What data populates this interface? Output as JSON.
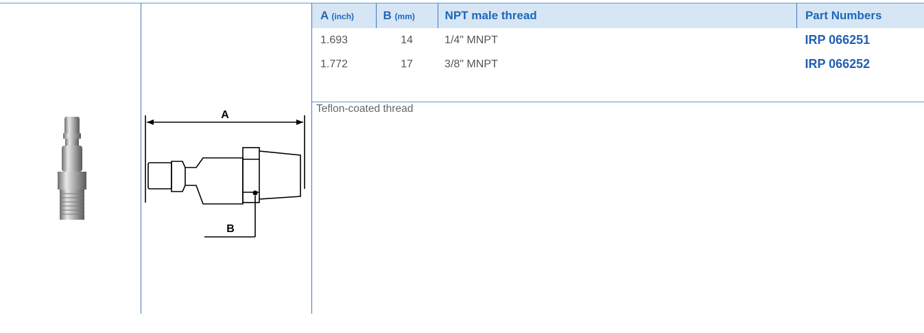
{
  "table": {
    "headers": {
      "a": {
        "label": "A",
        "unit": "(inch)"
      },
      "b": {
        "label": "B",
        "unit": "(mm)"
      },
      "thread": {
        "label": "NPT male thread"
      },
      "parts": {
        "label": "Part Numbers"
      }
    },
    "rows": [
      {
        "a": "1.693",
        "b": "14",
        "thread": "1/4\" MNPT",
        "part": "IRP 066251"
      },
      {
        "a": "1.772",
        "b": "17",
        "thread": "3/8\" MNPT",
        "part": "IRP 066252"
      }
    ]
  },
  "note": "Teflon-coated thread",
  "drawing": {
    "dim_a_label": "A",
    "dim_b_label": "B"
  },
  "colors": {
    "accent": "#1f66b8",
    "header_bg": "#d6e6f5",
    "rule": "#5a9bd5"
  }
}
